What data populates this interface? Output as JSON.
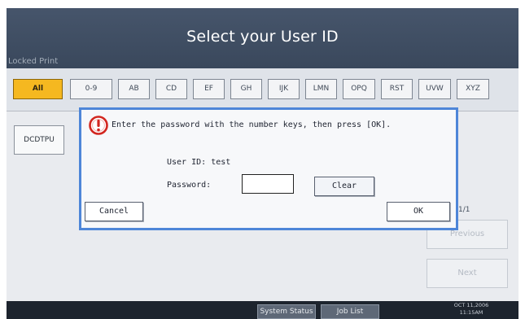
{
  "header": {
    "title": "Select your User ID",
    "subtitle": "Locked Print"
  },
  "tabs": [
    {
      "label": "All",
      "active": true
    },
    {
      "label": "0-9",
      "active": false
    },
    {
      "label": "AB",
      "active": false
    },
    {
      "label": "CD",
      "active": false
    },
    {
      "label": "EF",
      "active": false
    },
    {
      "label": "GH",
      "active": false
    },
    {
      "label": "IJK",
      "active": false
    },
    {
      "label": "LMN",
      "active": false
    },
    {
      "label": "OPQ",
      "active": false
    },
    {
      "label": "RST",
      "active": false
    },
    {
      "label": "UVW",
      "active": false
    },
    {
      "label": "XYZ",
      "active": false
    }
  ],
  "user_list": {
    "items": [
      "DCDTPU"
    ],
    "page_indicator": "1/1"
  },
  "side_buttons": {
    "previous_label": "Previous",
    "next_label": "Next"
  },
  "dialog": {
    "icon": "warning-icon",
    "message": "Enter the password with the number keys, then press [OK].",
    "user_id_label": "User ID:",
    "user_id_value": "test",
    "password_label": "Password:",
    "password_value": "",
    "clear_label": "Clear",
    "cancel_label": "Cancel",
    "ok_label": "OK"
  },
  "footer": {
    "system_status_label": "System Status",
    "job_list_label": "Job List",
    "date": "OCT 11,2006",
    "time": "11:15AM"
  },
  "colors": {
    "header_bg": "#3f4d62",
    "active_tab": "#f5b820",
    "dialog_border": "#4e86d8",
    "warning_icon": "#d2261f"
  }
}
